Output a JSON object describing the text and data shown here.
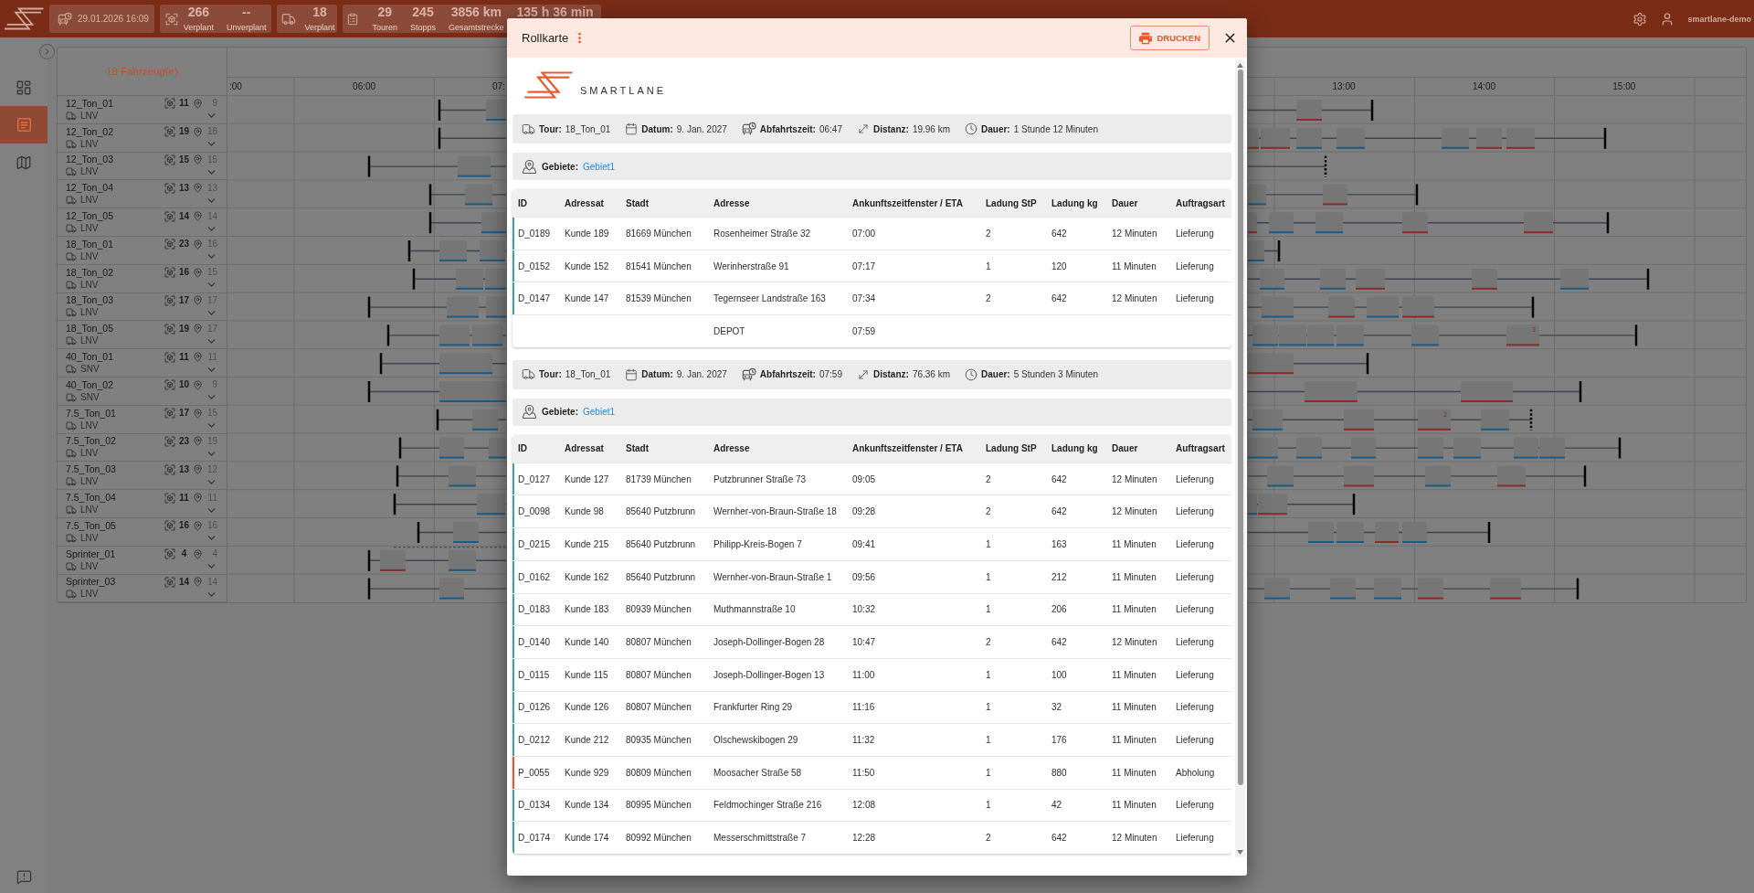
{
  "top_bar": {
    "stat_cards": [
      {
        "kind": "datetime",
        "stats": [
          {
            "value": "29.01.2026 16:09"
          }
        ]
      },
      {
        "kind": "orders",
        "stats": [
          {
            "value": "266",
            "label": "Verplant"
          },
          {
            "value": "--",
            "label": "Unverplant"
          }
        ]
      },
      {
        "kind": "vehicles",
        "stats": [
          {
            "value": "18",
            "label": "Verplant"
          }
        ]
      },
      {
        "kind": "tours",
        "stats": [
          {
            "value": "29",
            "label": "Touren"
          },
          {
            "value": "245",
            "label": "Stopps"
          },
          {
            "value": "3856 km",
            "label": "Gesamtstrecke"
          },
          {
            "value": "135 h 36 min"
          }
        ]
      }
    ],
    "user": "smartlane-demo"
  },
  "sidebar": {
    "items": [
      {
        "kind": "dashboard",
        "selected": false
      },
      {
        "kind": "tours",
        "selected": true
      },
      {
        "kind": "map",
        "selected": false
      }
    ]
  },
  "vehicle_panel": {
    "title": "18 Fahrzeug(e)",
    "time_labels": [
      ":00",
      "06:00",
      "07:",
      "13:00",
      "14:00",
      "15:00"
    ],
    "vehicles": [
      {
        "name": "12_Ton_01",
        "type": "LNV",
        "orders": "11",
        "stops": "9"
      },
      {
        "name": "12_Ton_02",
        "type": "LNV",
        "orders": "19",
        "stops": "18"
      },
      {
        "name": "12_Ton_03",
        "type": "LNV",
        "orders": "15",
        "stops": "15"
      },
      {
        "name": "12_Ton_04",
        "type": "LNV",
        "orders": "13",
        "stops": "13"
      },
      {
        "name": "12_Ton_05",
        "type": "LNV",
        "orders": "14",
        "stops": "14"
      },
      {
        "name": "18_Ton_01",
        "type": "LNV",
        "orders": "23",
        "stops": "16"
      },
      {
        "name": "18_Ton_02",
        "type": "LNV",
        "orders": "16",
        "stops": "15"
      },
      {
        "name": "18_Ton_03",
        "type": "LNV",
        "orders": "17",
        "stops": "17"
      },
      {
        "name": "18_Ton_05",
        "type": "LNV",
        "orders": "19",
        "stops": "17",
        "badge": "3"
      },
      {
        "name": "40_Ton_01",
        "type": "SNV",
        "orders": "11",
        "stops": "11"
      },
      {
        "name": "40_Ton_02",
        "type": "SNV",
        "orders": "10",
        "stops": "9"
      },
      {
        "name": "7.5_Ton_01",
        "type": "LNV",
        "orders": "17",
        "stops": "15",
        "badge": "2"
      },
      {
        "name": "7.5_Ton_02",
        "type": "LNV",
        "orders": "23",
        "stops": "19"
      },
      {
        "name": "7.5_Ton_03",
        "type": "LNV",
        "orders": "13",
        "stops": "12"
      },
      {
        "name": "7.5_Ton_04",
        "type": "LNV",
        "orders": "11",
        "stops": "11"
      },
      {
        "name": "7.5_Ton_05",
        "type": "LNV",
        "orders": "16",
        "stops": "16"
      },
      {
        "name": "Sprinter_01",
        "type": "LNV",
        "orders": "4",
        "stops": "4"
      },
      {
        "name": "Sprinter_03",
        "type": "LNV",
        "orders": "14",
        "stops": "14"
      }
    ]
  },
  "dialog": {
    "title": "Rollkarte",
    "print_button": "DRUCKEN",
    "logo_text": "SMARTLANE",
    "tours": [
      {
        "info": [
          {
            "kind": "tour",
            "label": "Tour:",
            "value": "18_Ton_01"
          },
          {
            "kind": "date",
            "label": "Datum:",
            "value": "9. Jan. 2027"
          },
          {
            "kind": "departure",
            "label": "Abfahrtszeit:",
            "value": "06:47"
          },
          {
            "kind": "distance",
            "label": "Distanz:",
            "value": "19.96 km"
          },
          {
            "kind": "duration",
            "label": "Dauer:",
            "value": "1 Stunde 12 Minuten"
          }
        ],
        "areas_label": "Gebiete:",
        "areas": [
          "Gebiet1"
        ],
        "columns": [
          "ID",
          "Adressat",
          "Stadt",
          "Adresse",
          "Ankunftszeitfenster / ETA",
          "Ladung StP",
          "Ladung kg",
          "Dauer",
          "Auftragsart"
        ],
        "rows": [
          {
            "kind": "stop",
            "color": "#4a9d9c",
            "id": "D_0189",
            "recipient": "Kunde 189",
            "city": "81669 München",
            "address": "Rosenheimer Straße 32",
            "eta": "07:00",
            "pieces": "2",
            "weight": "642",
            "duration": "12 Minuten",
            "order_type": "Lieferung"
          },
          {
            "kind": "stop",
            "color": "#4a9d9c",
            "id": "D_0152",
            "recipient": "Kunde 152",
            "city": "81541 München",
            "address": "Werinherstraße 91",
            "eta": "07:17",
            "pieces": "1",
            "weight": "120",
            "duration": "11 Minuten",
            "order_type": "Lieferung"
          },
          {
            "kind": "stop",
            "color": "#4a9d9c",
            "id": "D_0147",
            "recipient": "Kunde 147",
            "city": "81539 München",
            "address": "Tegernseer Landstraße 163",
            "eta": "07:34",
            "pieces": "2",
            "weight": "642",
            "duration": "12 Minuten",
            "order_type": "Lieferung"
          },
          {
            "kind": "depot",
            "address": "DEPOT",
            "eta": "07:59"
          }
        ]
      },
      {
        "info": [
          {
            "kind": "tour",
            "label": "Tour:",
            "value": "18_Ton_01"
          },
          {
            "kind": "date",
            "label": "Datum:",
            "value": "9. Jan. 2027"
          },
          {
            "kind": "departure",
            "label": "Abfahrtszeit:",
            "value": "07:59"
          },
          {
            "kind": "distance",
            "label": "Distanz:",
            "value": "76.36 km"
          },
          {
            "kind": "duration",
            "label": "Dauer:",
            "value": "5 Stunden 3 Minuten"
          }
        ],
        "areas_label": "Gebiete:",
        "areas": [
          "Gebiet1"
        ],
        "columns": [
          "ID",
          "Adressat",
          "Stadt",
          "Adresse",
          "Ankunftszeitfenster / ETA",
          "Ladung StP",
          "Ladung kg",
          "Dauer",
          "Auftragsart"
        ],
        "rows": [
          {
            "kind": "stop",
            "color": "#4a9d9c",
            "id": "D_0127",
            "recipient": "Kunde 127",
            "city": "81739 München",
            "address": "Putzbrunner Straße 73",
            "eta": "09:05",
            "pieces": "2",
            "weight": "642",
            "duration": "12 Minuten",
            "order_type": "Lieferung"
          },
          {
            "kind": "stop",
            "color": "#4a9d9c",
            "id": "D_0098",
            "recipient": "Kunde 98",
            "city": "85640 Putzbrunn",
            "address": "Wernher-von-Braun-Straße 18",
            "eta": "09:28",
            "pieces": "2",
            "weight": "642",
            "duration": "12 Minuten",
            "order_type": "Lieferung"
          },
          {
            "kind": "stop",
            "color": "#4a9d9c",
            "id": "D_0215",
            "recipient": "Kunde 215",
            "city": "85640 Putzbrunn",
            "address": "Philipp-Kreis-Bogen 7",
            "eta": "09:41",
            "pieces": "1",
            "weight": "163",
            "duration": "11 Minuten",
            "order_type": "Lieferung"
          },
          {
            "kind": "stop",
            "color": "#4a9d9c",
            "id": "D_0162",
            "recipient": "Kunde 162",
            "city": "85640 Putzbrunn",
            "address": "Wernher-von-Braun-Straße 1",
            "eta": "09:56",
            "pieces": "1",
            "weight": "212",
            "duration": "11 Minuten",
            "order_type": "Lieferung"
          },
          {
            "kind": "stop",
            "color": "#4a9d9c",
            "id": "D_0183",
            "recipient": "Kunde 183",
            "city": "80939 München",
            "address": "Muthmannstraße 10",
            "eta": "10:32",
            "pieces": "1",
            "weight": "206",
            "duration": "11 Minuten",
            "order_type": "Lieferung"
          },
          {
            "kind": "stop",
            "color": "#4a9d9c",
            "id": "D_0140",
            "recipient": "Kunde 140",
            "city": "80807 München",
            "address": "Joseph-Dollinger-Bogen 28",
            "eta": "10:47",
            "pieces": "2",
            "weight": "642",
            "duration": "12 Minuten",
            "order_type": "Lieferung"
          },
          {
            "kind": "stop",
            "color": "#4a9d9c",
            "id": "D_0115",
            "recipient": "Kunde 115",
            "city": "80807 München",
            "address": "Joseph-Dollinger-Bogen 13",
            "eta": "11:00",
            "pieces": "1",
            "weight": "100",
            "duration": "11 Minuten",
            "order_type": "Lieferung"
          },
          {
            "kind": "stop",
            "color": "#4a9d9c",
            "id": "D_0126",
            "recipient": "Kunde 126",
            "city": "80807 München",
            "address": "Frankfurter Ring 29",
            "eta": "11:16",
            "pieces": "1",
            "weight": "32",
            "duration": "11 Minuten",
            "order_type": "Lieferung"
          },
          {
            "kind": "stop",
            "color": "#4a9d9c",
            "id": "D_0212",
            "recipient": "Kunde 212",
            "city": "80935 München",
            "address": "Olschewskibogen 29",
            "eta": "11:32",
            "pieces": "1",
            "weight": "176",
            "duration": "11 Minuten",
            "order_type": "Lieferung"
          },
          {
            "kind": "stop",
            "color": "#e5533d",
            "id": "P_0055",
            "recipient": "Kunde 929",
            "city": "80809 München",
            "address": "Moosacher Straße 58",
            "eta": "11:50",
            "pieces": "1",
            "weight": "880",
            "duration": "11 Minuten",
            "order_type": "Abholung"
          },
          {
            "kind": "stop",
            "color": "#4a9d9c",
            "id": "D_0134",
            "recipient": "Kunde 134",
            "city": "80995 München",
            "address": "Feldmochinger Straße 216",
            "eta": "12:08",
            "pieces": "1",
            "weight": "42",
            "duration": "11 Minuten",
            "order_type": "Lieferung"
          },
          {
            "kind": "stop",
            "color": "#4a9d9c",
            "id": "D_0174",
            "recipient": "Kunde 174",
            "city": "80992 München",
            "address": "Messerschmittstraße 7",
            "eta": "12:28",
            "pieces": "2",
            "weight": "642",
            "duration": "12 Minuten",
            "order_type": "Lieferung"
          }
        ]
      }
    ]
  }
}
